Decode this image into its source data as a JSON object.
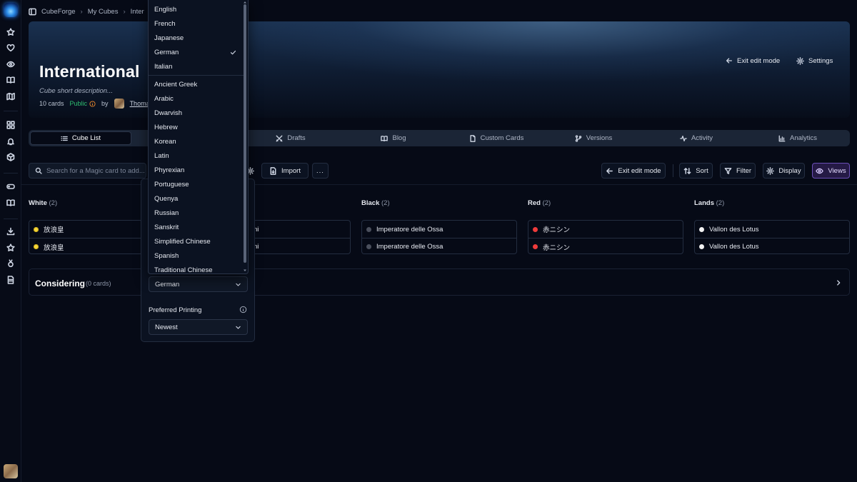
{
  "breadcrumb": [
    "CubeForge",
    "My Cubes",
    "Inter"
  ],
  "hero": {
    "title": "International",
    "description": "Cube short description...",
    "card_count": "10 cards",
    "visibility": "Public",
    "by": "by",
    "owner": "Thoma",
    "exit_edit": "Exit edit mode",
    "settings": "Settings"
  },
  "tabs": [
    {
      "label": "Cube List",
      "icon": "list-icon"
    },
    {
      "label": "Drafts",
      "icon": "crossed-swords-icon"
    },
    {
      "label": "Blog",
      "icon": "book-icon"
    },
    {
      "label": "Custom Cards",
      "icon": "file-card-icon"
    },
    {
      "label": "Versions",
      "icon": "git-branch-icon"
    },
    {
      "label": "Activity",
      "icon": "pulse-icon"
    },
    {
      "label": "Analytics",
      "icon": "bar-chart-icon"
    }
  ],
  "toolbar": {
    "search_placeholder": "Search for a Magic card to add...",
    "import": "Import",
    "more": "...",
    "exit_edit": "Exit edit mode",
    "sort": "Sort",
    "filter": "Filter",
    "display": "Display",
    "views": "Views"
  },
  "columns": [
    {
      "name": "White",
      "count": "(2)",
      "cards": [
        {
          "name": "放浪皇",
          "color": "#f5d63a"
        },
        {
          "name": "放浪皇",
          "color": "#f5d63a"
        }
      ]
    },
    {
      "name": "",
      "count": "",
      "cards": [
        {
          "name": "ni",
          "color": ""
        },
        {
          "name": "ni",
          "color": ""
        }
      ]
    },
    {
      "name": "Black",
      "count": "(2)",
      "cards": [
        {
          "name": "Imperatore delle Ossa",
          "color": "#4a4f5c"
        },
        {
          "name": "Imperatore delle Ossa",
          "color": "#4a4f5c"
        }
      ]
    },
    {
      "name": "Red",
      "count": "(2)",
      "cards": [
        {
          "name": "赤ニシン",
          "color": "#ef3b3b"
        },
        {
          "name": "赤ニシン",
          "color": "#ef3b3b"
        }
      ]
    },
    {
      "name": "Lands",
      "count": "(2)",
      "cards": [
        {
          "name": "Vallon des Lotus",
          "color": "#f2f2f2"
        },
        {
          "name": "Vallon des Lotus",
          "color": "#f2f2f2"
        }
      ]
    }
  ],
  "considering": {
    "title": "Considering",
    "count": "(0 cards)"
  },
  "display_panel": {
    "language_value": "German",
    "preferred_printing_label": "Preferred Printing",
    "preferred_printing_value": "Newest"
  },
  "language_menu": {
    "selected": "German",
    "primary": [
      "English",
      "French",
      "Japanese",
      "German",
      "Italian"
    ],
    "secondary": [
      "Ancient Greek",
      "Arabic",
      "Dwarvish",
      "Hebrew",
      "Korean",
      "Latin",
      "Phyrexian",
      "Portuguese",
      "Quenya",
      "Russian",
      "Sanskrit",
      "Simplified Chinese",
      "Spanish",
      "Traditional Chinese"
    ]
  }
}
